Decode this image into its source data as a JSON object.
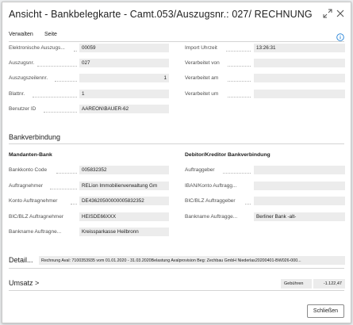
{
  "window": {
    "title": "Ansicht - Bankbelegkarte - Camt.053/Auszugsnr.: 027/ RECHNUNG"
  },
  "actions": [
    "Verwalten",
    "Seite"
  ],
  "general": {
    "left": [
      {
        "label": "Elektronische Auszugs...",
        "value": "00059"
      },
      {
        "label": "Auszugsnr.",
        "value": "027"
      },
      {
        "label": "Auszugszeilennr.",
        "value": "1"
      },
      {
        "label": "Blattnr.",
        "value": "1"
      },
      {
        "label": "Benutzer ID",
        "value": "AAREON\\BAUER-62"
      }
    ],
    "right": [
      {
        "label": "Import Uhrzeit",
        "value": "13:26:31"
      },
      {
        "label": "Verarbeitet von",
        "value": ""
      },
      {
        "label": "Verarbeitet am",
        "value": ""
      },
      {
        "label": "Verarbeitet um",
        "value": ""
      }
    ]
  },
  "bank": {
    "section_title": "Bankverbindung",
    "mandant": {
      "title": "Mandanten-Bank",
      "fields": [
        {
          "label": "Bankkonto Code",
          "value": "005832352"
        },
        {
          "label": "Auftragnehmer",
          "value": "RELion Immobilienverwaltung Gm"
        },
        {
          "label": "Konto Auftragnehmer",
          "value": "DE43620500000005832352"
        },
        {
          "label": "BIC/BLZ Auftragnehmer",
          "value": "HEISDE66XXX"
        },
        {
          "label": "Bankname Auftragne...",
          "value": "Kreissparkasse Heilbronn"
        }
      ]
    },
    "debitor": {
      "title": "Debitor/Kreditor Bankverbindung",
      "fields": [
        {
          "label": "Auftraggeber",
          "value": ""
        },
        {
          "label": "IBAN/Konto Auftragg...",
          "value": ""
        },
        {
          "label": "BIC/BLZ Auftraggeber",
          "value": ""
        },
        {
          "label": "Bankname Auftragge...",
          "value": "Berliner Bank -alt-"
        }
      ]
    }
  },
  "detail": {
    "title": "Detail...",
    "text": "Rechnung Aval: 7100353935 vom 01.01.2020 - 31.03.2020Belastung Avalprovision Beg: Zechbau GmbH Niederlas20200401-BW026-000..."
  },
  "umsatz": {
    "title": "Umsatz",
    "chevron": ">",
    "label": "Gebühren",
    "amount": "-1.122,47"
  },
  "footer": {
    "close_label": "Schließen"
  },
  "colors": {
    "info_icon": "#1e7fd6",
    "field_bg": "#ececec"
  }
}
